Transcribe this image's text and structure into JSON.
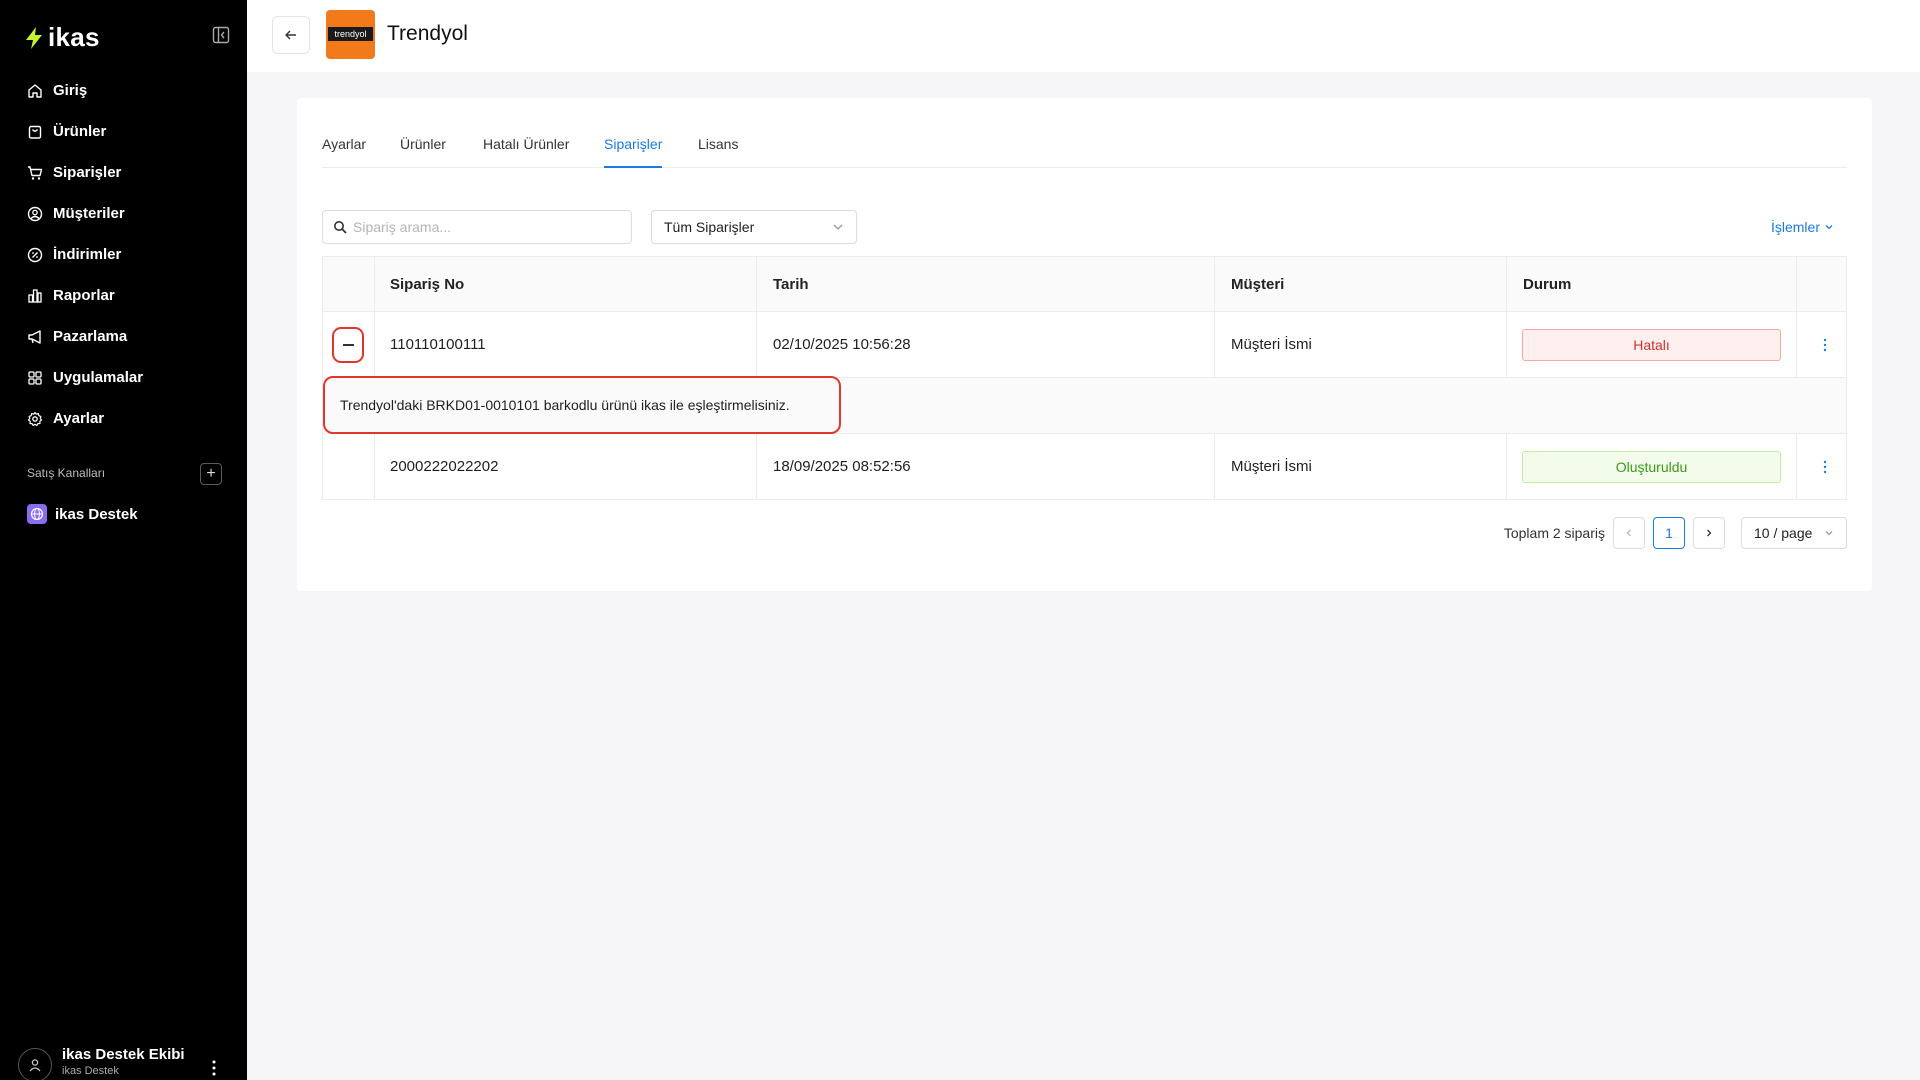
{
  "sidebar": {
    "logo_text": "ikas",
    "nav": [
      {
        "label": "Giriş",
        "icon": "home-icon"
      },
      {
        "label": "Ürünler",
        "icon": "bag-icon"
      },
      {
        "label": "Siparişler",
        "icon": "cart-icon"
      },
      {
        "label": "Müşteriler",
        "icon": "user-circle-icon"
      },
      {
        "label": "İndirimler",
        "icon": "discount-icon"
      },
      {
        "label": "Raporlar",
        "icon": "chart-icon"
      },
      {
        "label": "Pazarlama",
        "icon": "megaphone-icon"
      },
      {
        "label": "Uygulamalar",
        "icon": "apps-grid-icon"
      },
      {
        "label": "Ayarlar",
        "icon": "gear-icon"
      }
    ],
    "channels_title": "Satış Kanalları",
    "channel": {
      "label": "ikas Destek",
      "icon": "globe-icon"
    },
    "user": {
      "name": "ikas Destek Ekibi",
      "sub": "ikas Destek"
    }
  },
  "header": {
    "title": "Trendyol",
    "brand_logo_text": "trendyol",
    "brand_color": "#f27a1a"
  },
  "tabs": [
    {
      "label": "Ayarlar",
      "active": false
    },
    {
      "label": "Ürünler",
      "active": false
    },
    {
      "label": "Hatalı Ürünler",
      "active": false
    },
    {
      "label": "Siparişler",
      "active": true
    },
    {
      "label": "Lisans",
      "active": false
    }
  ],
  "filters": {
    "search_placeholder": "Sipariş arama...",
    "order_filter": "Tüm Siparişler",
    "actions_label": "İşlemler"
  },
  "table": {
    "columns": [
      "Sipariş No",
      "Tarih",
      "Müşteri",
      "Durum"
    ],
    "rows": [
      {
        "order_no": "110110100111",
        "date": "02/10/2025 10:56:28",
        "customer": "Müşteri İsmi",
        "status": "Hatalı",
        "status_type": "error",
        "expanded": true,
        "error_message": "Trendyol'daki BRKD01-0010101 barkodlu ürünü ikas ile eşleştirmelisiniz."
      },
      {
        "order_no": "2000222022202",
        "date": "18/09/2025 08:52:56",
        "customer": "Müşteri İsmi",
        "status": "Oluşturuldu",
        "status_type": "success",
        "expanded": false
      }
    ]
  },
  "pagination": {
    "total_text": "Toplam 2 sipariş",
    "current_page": "1",
    "page_size": "10 / page"
  },
  "colors": {
    "accent": "#1a7ce0",
    "error": "#d3302a",
    "success": "#3e9a1d",
    "highlight": "#e0362b"
  }
}
